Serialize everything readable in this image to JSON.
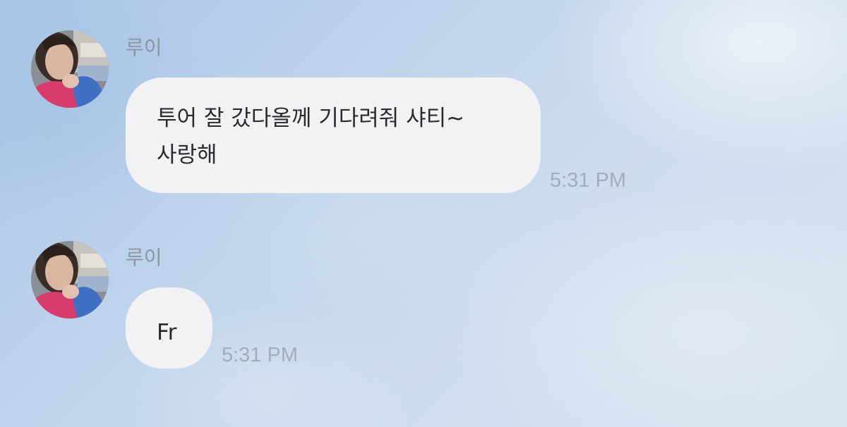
{
  "messages": [
    {
      "sender": "루이",
      "lines": [
        "투어 잘 갔다올께 기다려줘 샤티~",
        "사랑해"
      ],
      "time": "5:31 PM"
    },
    {
      "sender": "루이",
      "lines": [
        "Fr"
      ],
      "time": "5:31 PM"
    }
  ],
  "icons": {
    "avatar": "profile-photo-avatar"
  },
  "colors": {
    "bubble": "#f2f2f5",
    "message_text": "#2b2b2e",
    "sender_name": "#8c96a3",
    "timestamp": "#a3adb9"
  }
}
